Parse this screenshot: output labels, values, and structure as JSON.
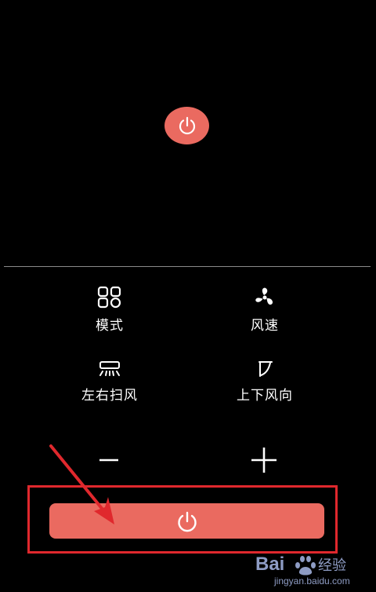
{
  "controls": {
    "mode": {
      "label": "模式",
      "icon": "mode-grid-icon"
    },
    "fan_speed": {
      "label": "风速",
      "icon": "fan-icon"
    },
    "horizontal_swing": {
      "label": "左右扫风",
      "icon": "horizontal-swing-icon"
    },
    "vertical_direction": {
      "label": "上下风向",
      "icon": "vertical-direction-icon"
    },
    "decrease": {
      "icon": "minus-icon"
    },
    "increase": {
      "icon": "plus-icon"
    }
  },
  "power": {
    "icon": "power-icon",
    "color": "#ea6a60"
  },
  "annotation": {
    "highlight_color": "#e0282d",
    "arrow_color": "#e0282d"
  },
  "watermark": {
    "brand": "Bai",
    "brand_suffix": "经验",
    "url": "jingyan.baidu.com"
  }
}
